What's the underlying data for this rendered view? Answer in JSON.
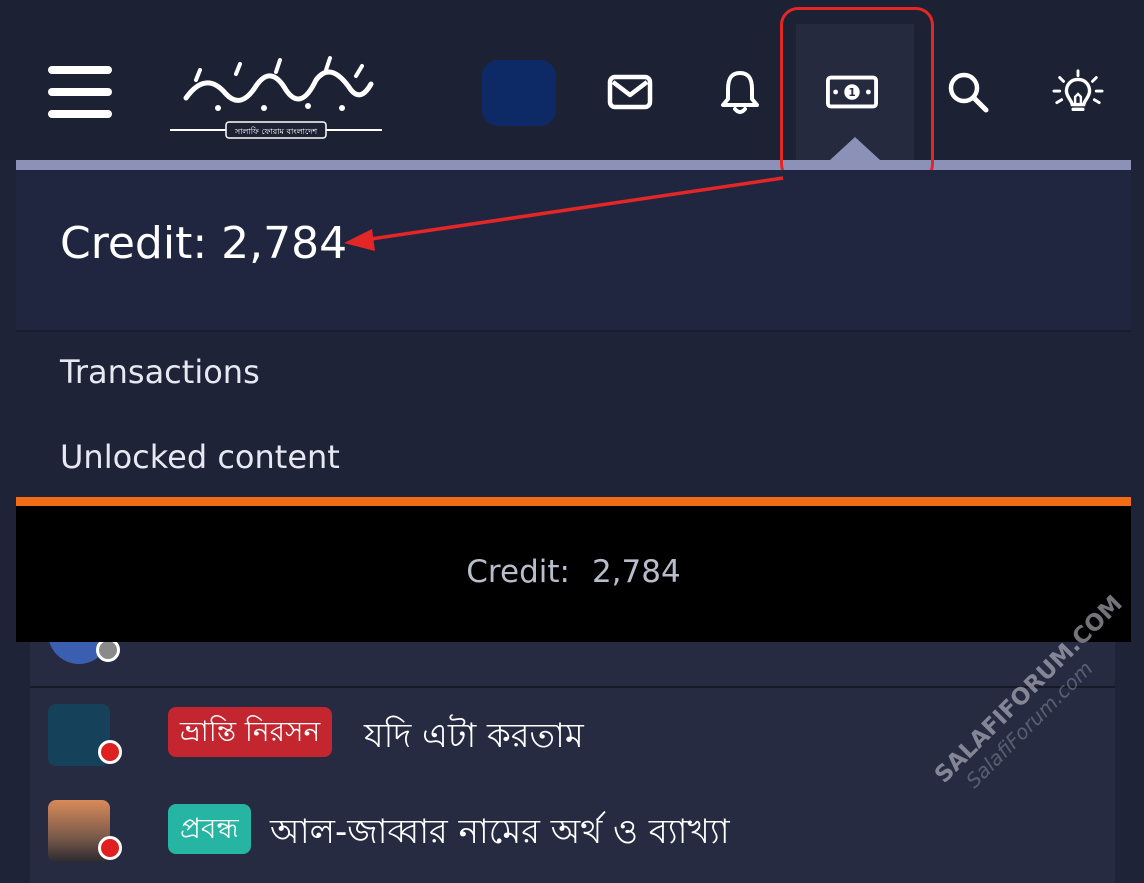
{
  "header": {
    "logo_subtitle": "সালাফি ফোরাম বাংলাদেশ",
    "icons": [
      "menu-icon",
      "envelope-icon",
      "bell-icon",
      "banknote-icon",
      "search-icon",
      "lightbulb-icon"
    ],
    "highlight_color": "#e52626",
    "banknote_digit": "1"
  },
  "credit_menu": {
    "title": "Credit: 2,784",
    "links": [
      "Transactions",
      "Unlocked content"
    ],
    "footer_label": "Credit:",
    "footer_value": "2,784",
    "accent_color": "#f26c16"
  },
  "threads": [
    {
      "prefix": "ভ্রান্তি নিরসন",
      "prefix_color": "#c3262f",
      "title": "যদি এটা করতাম"
    },
    {
      "prefix": "প্রবন্ধ",
      "prefix_color": "#26b5a3",
      "title": "আল-জাব্বার নামের অর্থ ও ব্যাখ্যা"
    }
  ],
  "watermark": {
    "line1": "SALAFIFORUM.COM",
    "line2": "SalafiForum.com"
  }
}
